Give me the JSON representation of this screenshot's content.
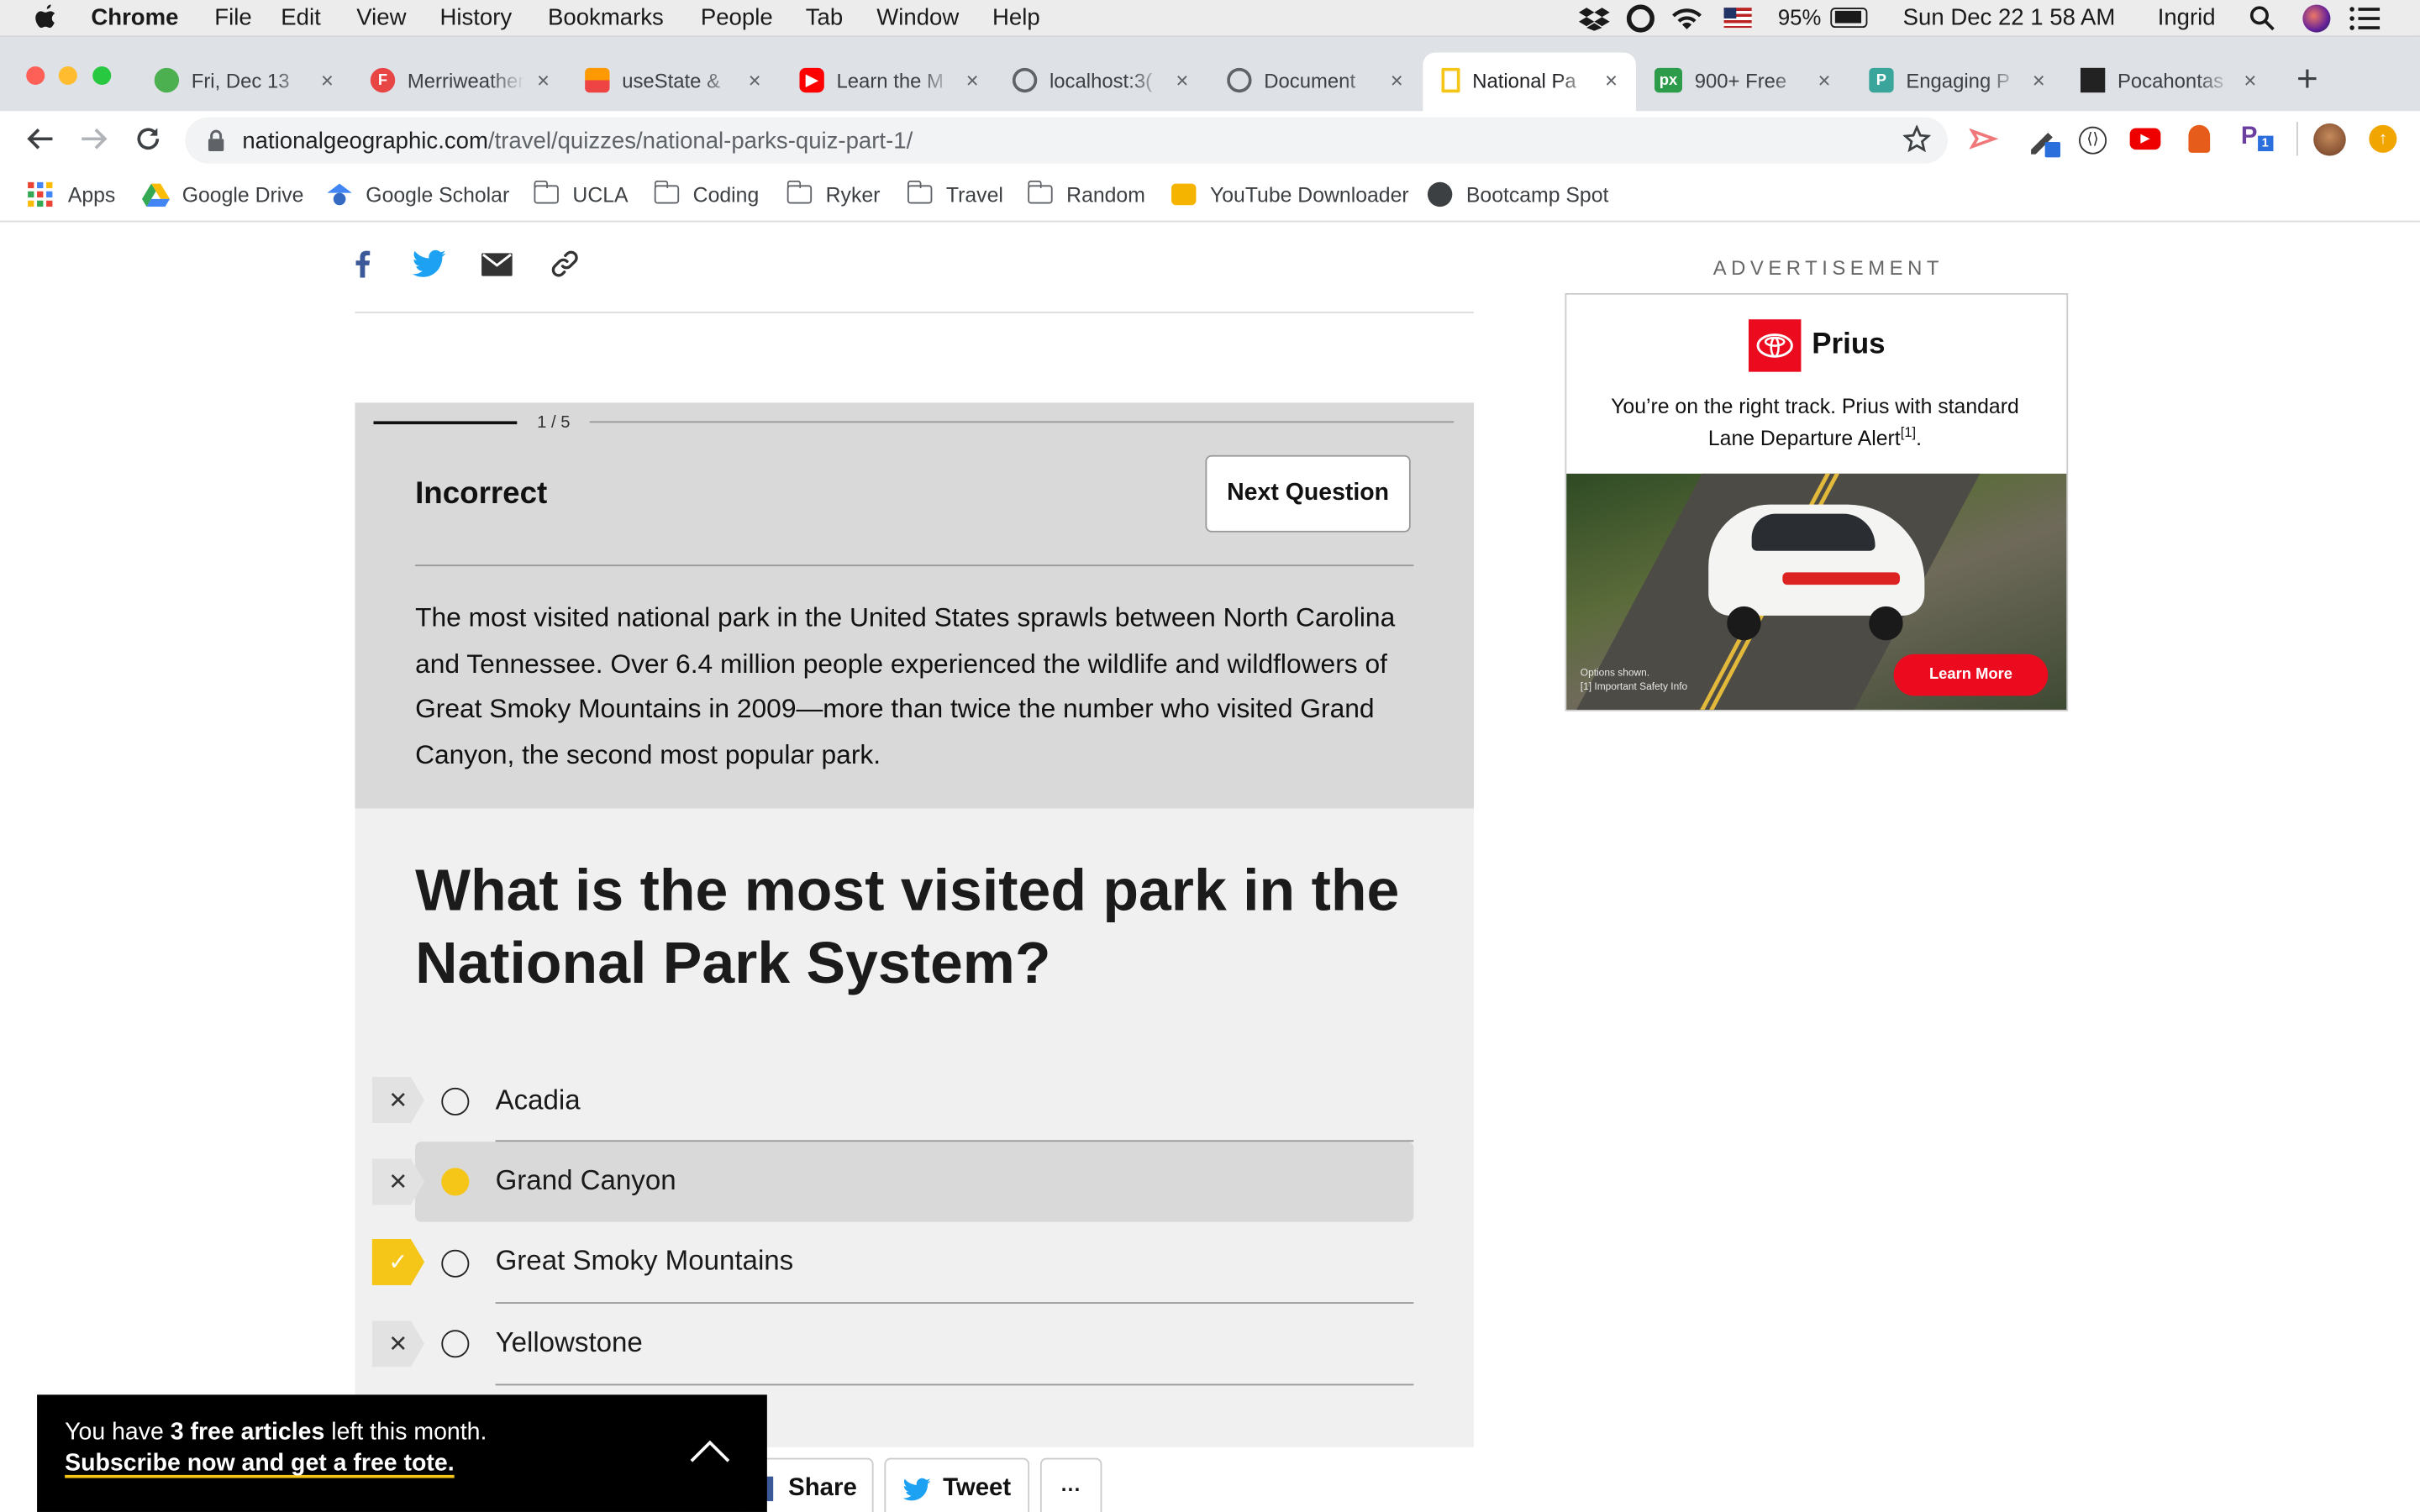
{
  "menubar": {
    "app_name": "Chrome",
    "items": [
      "File",
      "Edit",
      "View",
      "History",
      "Bookmarks",
      "People",
      "Tab",
      "Window",
      "Help"
    ],
    "battery": "95%",
    "datetime": "Sun Dec 22  1 58 AM",
    "user": "Ingrid"
  },
  "tabs": [
    {
      "title": "Fri, Dec 13",
      "close": "×"
    },
    {
      "title": "Merriweather",
      "close": "×"
    },
    {
      "title": "useState &",
      "close": "×"
    },
    {
      "title": "Learn the M",
      "close": "×"
    },
    {
      "title": "localhost:3(",
      "close": "×"
    },
    {
      "title": "Document",
      "close": "×"
    },
    {
      "title": "National Pa",
      "close": "×"
    },
    {
      "title": "900+ Free",
      "close": "×"
    },
    {
      "title": "Engaging P",
      "close": "×"
    },
    {
      "title": "Pocahontas",
      "close": "×"
    }
  ],
  "address": {
    "domain": "nationalgeographic.com",
    "path": "/travel/quizzes/national-parks-quiz-part-1/"
  },
  "bookmarks": [
    "Apps",
    "Google Drive",
    "Google Scholar",
    "UCLA",
    "Coding",
    "Ryker",
    "Travel",
    "Random",
    "YouTube Downloader",
    "Bootcamp Spot"
  ],
  "quiz": {
    "progress": "1 / 5",
    "progress_fraction": 0.2,
    "result": "Incorrect",
    "next_label": "Next Question",
    "explanation": "The most visited national park in the United States sprawls between North Carolina and Tennessee. Over 6.4 million people experienced the wildlife and wildflowers of Great Smoky Mountains in 2009—more than twice the number who visited Grand Canyon, the second most popular park.",
    "question": "What is the most visited park in the National Park System?",
    "answers": [
      {
        "label": "Acadia",
        "status": "wrong",
        "selected": false
      },
      {
        "label": "Grand Canyon",
        "status": "wrong",
        "selected": true
      },
      {
        "label": "Great Smoky Mountains",
        "status": "correct",
        "selected": false
      },
      {
        "label": "Yellowstone",
        "status": "wrong",
        "selected": false
      }
    ]
  },
  "ad": {
    "label": "ADVERTISEMENT",
    "brand": "Prius",
    "tagline": "You’re on the right track. Prius with standard Lane Departure Alert",
    "footnote": "[1]",
    "fineprint_1": "Options shown.",
    "fineprint_2": "[1] Important Safety Info",
    "cta": "Learn More"
  },
  "paywall": {
    "line1_pre": "You have ",
    "line1_bold": "3 free articles",
    "line1_post": " left this month.",
    "line2": "Subscribe now and get a free tote."
  },
  "sharebar": {
    "share": "Share",
    "tweet": "Tweet",
    "more": "···"
  },
  "colors": {
    "accent_yellow": "#f5c518",
    "toyota_red": "#eb0a1e",
    "quiz_gray": "#d9d9d9"
  }
}
